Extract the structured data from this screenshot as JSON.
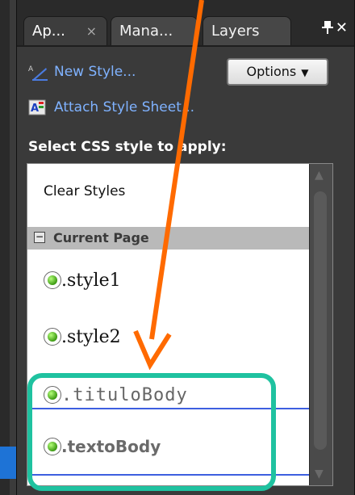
{
  "tabs": [
    {
      "label": "Ap...",
      "close": "×"
    },
    {
      "label": "Mana..."
    },
    {
      "label": "Layers"
    }
  ],
  "toolbar": {
    "new_style": "New Style...",
    "attach_style_sheet": "Attach Style Sheet...",
    "options_label": "Options"
  },
  "section": {
    "prompt": "Select CSS style to apply:"
  },
  "list": {
    "clear_styles": "Clear Styles",
    "group_current_page": "Current Page",
    "styles": [
      {
        "name": ".style1"
      },
      {
        "name": ".style2"
      },
      {
        "name": ".tituloBody"
      },
      {
        "name": ".textoBody"
      }
    ]
  },
  "colors": {
    "annotation_box": "#1fc2a0",
    "arrow": "#ff6a00",
    "link_text": "#7fb2ff",
    "selection_border": "#3d5fe0"
  }
}
